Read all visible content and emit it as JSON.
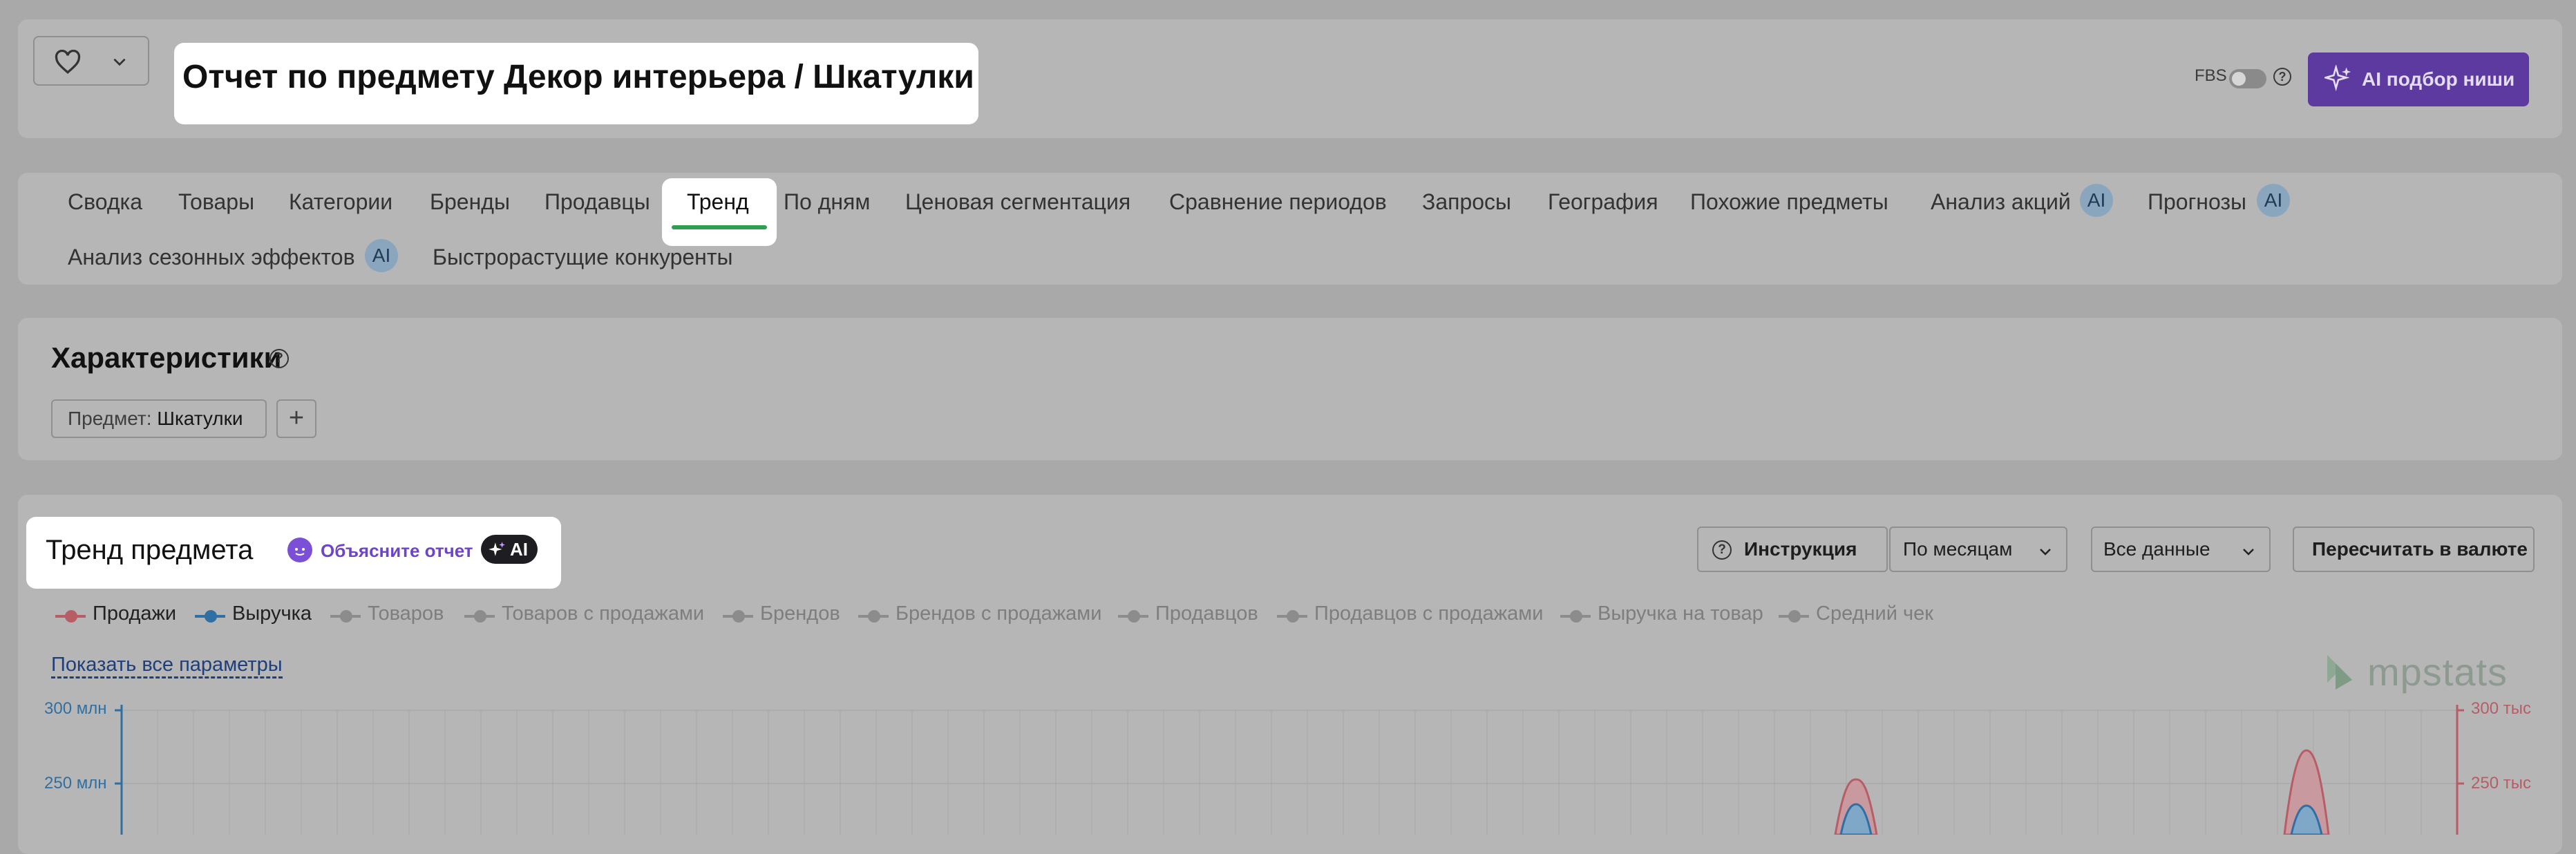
{
  "header": {
    "title": "Отчет по предмету Декор интерьера / Шкатулки",
    "fbs_label": "FBS",
    "ai_button": "AI подбор ниши"
  },
  "tabs": [
    {
      "label": "Сводка"
    },
    {
      "label": "Товары"
    },
    {
      "label": "Категории"
    },
    {
      "label": "Бренды"
    },
    {
      "label": "Продавцы"
    },
    {
      "label": "Тренд",
      "active": true
    },
    {
      "label": "По дням"
    },
    {
      "label": "Ценовая сегментация"
    },
    {
      "label": "Сравнение периодов"
    },
    {
      "label": "Запросы"
    },
    {
      "label": "География"
    },
    {
      "label": "Похожие предметы"
    },
    {
      "label": "Анализ акций",
      "badge": "AI"
    },
    {
      "label": "Прогнозы",
      "badge": "AI"
    },
    {
      "label": "Анализ сезонных эффектов",
      "badge": "AI"
    },
    {
      "label": "Быстрорастущие конкуренты"
    }
  ],
  "characteristics": {
    "title": "Характеристики",
    "chip_label": "Предмет:",
    "chip_value": "Шкатулки",
    "add": "+"
  },
  "trend": {
    "title": "Тренд предмета",
    "explain": "Объясните отчет",
    "ai_badge": "AI",
    "instruction": "Инструкция",
    "period": "По месяцам",
    "data_range": "Все данные",
    "recalc": "Пересчитать в валюте",
    "show_all": "Показать все параметры",
    "brand": "mpstats",
    "legend": [
      {
        "label": "Продажи",
        "color": "#b85c66",
        "active": true
      },
      {
        "label": "Выручка",
        "color": "#2f6fa3",
        "active": true
      },
      {
        "label": "Товаров",
        "color": "#8c8c8c",
        "active": false
      },
      {
        "label": "Товаров с продажами",
        "color": "#8c8c8c",
        "active": false
      },
      {
        "label": "Брендов",
        "color": "#8c8c8c",
        "active": false
      },
      {
        "label": "Брендов с продажами",
        "color": "#8c8c8c",
        "active": false
      },
      {
        "label": "Продавцов",
        "color": "#8c8c8c",
        "active": false
      },
      {
        "label": "Продавцов с продажами",
        "color": "#8c8c8c",
        "active": false
      },
      {
        "label": "Выручка на товар",
        "color": "#8c8c8c",
        "active": false
      },
      {
        "label": "Средний чек",
        "color": "#8c8c8c",
        "active": false
      }
    ],
    "left_axis": [
      "300 млн",
      "250 млн"
    ],
    "right_axis": [
      "300 тыс",
      "250 тыс"
    ]
  }
}
